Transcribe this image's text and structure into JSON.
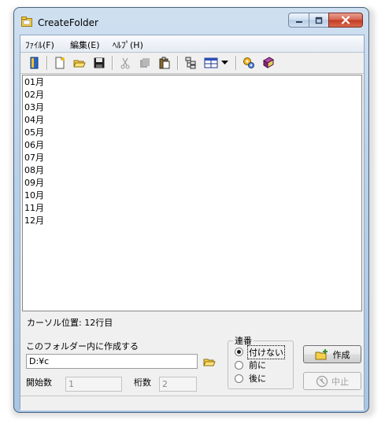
{
  "window": {
    "title": "CreateFolder"
  },
  "menu": {
    "items": [
      {
        "label": "ﾌｧｲﾙ(F)"
      },
      {
        "label": "編集(E)"
      },
      {
        "label": "ﾍﾙﾌﾟ(H)"
      }
    ]
  },
  "toolbar": {
    "icons": [
      "book-exit-icon",
      "new-file-icon",
      "open-folder-icon",
      "save-icon",
      "cut-icon",
      "copy-icon",
      "paste-icon",
      "tree-icon",
      "window-grid-icon",
      "dropdown-arrow-icon",
      "settings-icon",
      "help-book-icon"
    ]
  },
  "editor": {
    "lines": [
      "01月",
      "02月",
      "03月",
      "04月",
      "05月",
      "06月",
      "07月",
      "08月",
      "09月",
      "10月",
      "11月",
      "12月"
    ]
  },
  "status": {
    "cursor_label": "カーソル位置: 12行目"
  },
  "form": {
    "folder_label": "このフォルダー内に作成する",
    "folder_value": "D:¥c",
    "start_label": "開始数",
    "start_value": "1",
    "digits_label": "桁数",
    "digits_value": "2"
  },
  "numbering": {
    "title": "連番",
    "options": [
      {
        "label": "付けない",
        "selected": true
      },
      {
        "label": "前に",
        "selected": false
      },
      {
        "label": "後に",
        "selected": false
      }
    ]
  },
  "buttons": {
    "create": "作成",
    "cancel": "中止"
  },
  "colors": {
    "accent": "#1a4f9c"
  }
}
